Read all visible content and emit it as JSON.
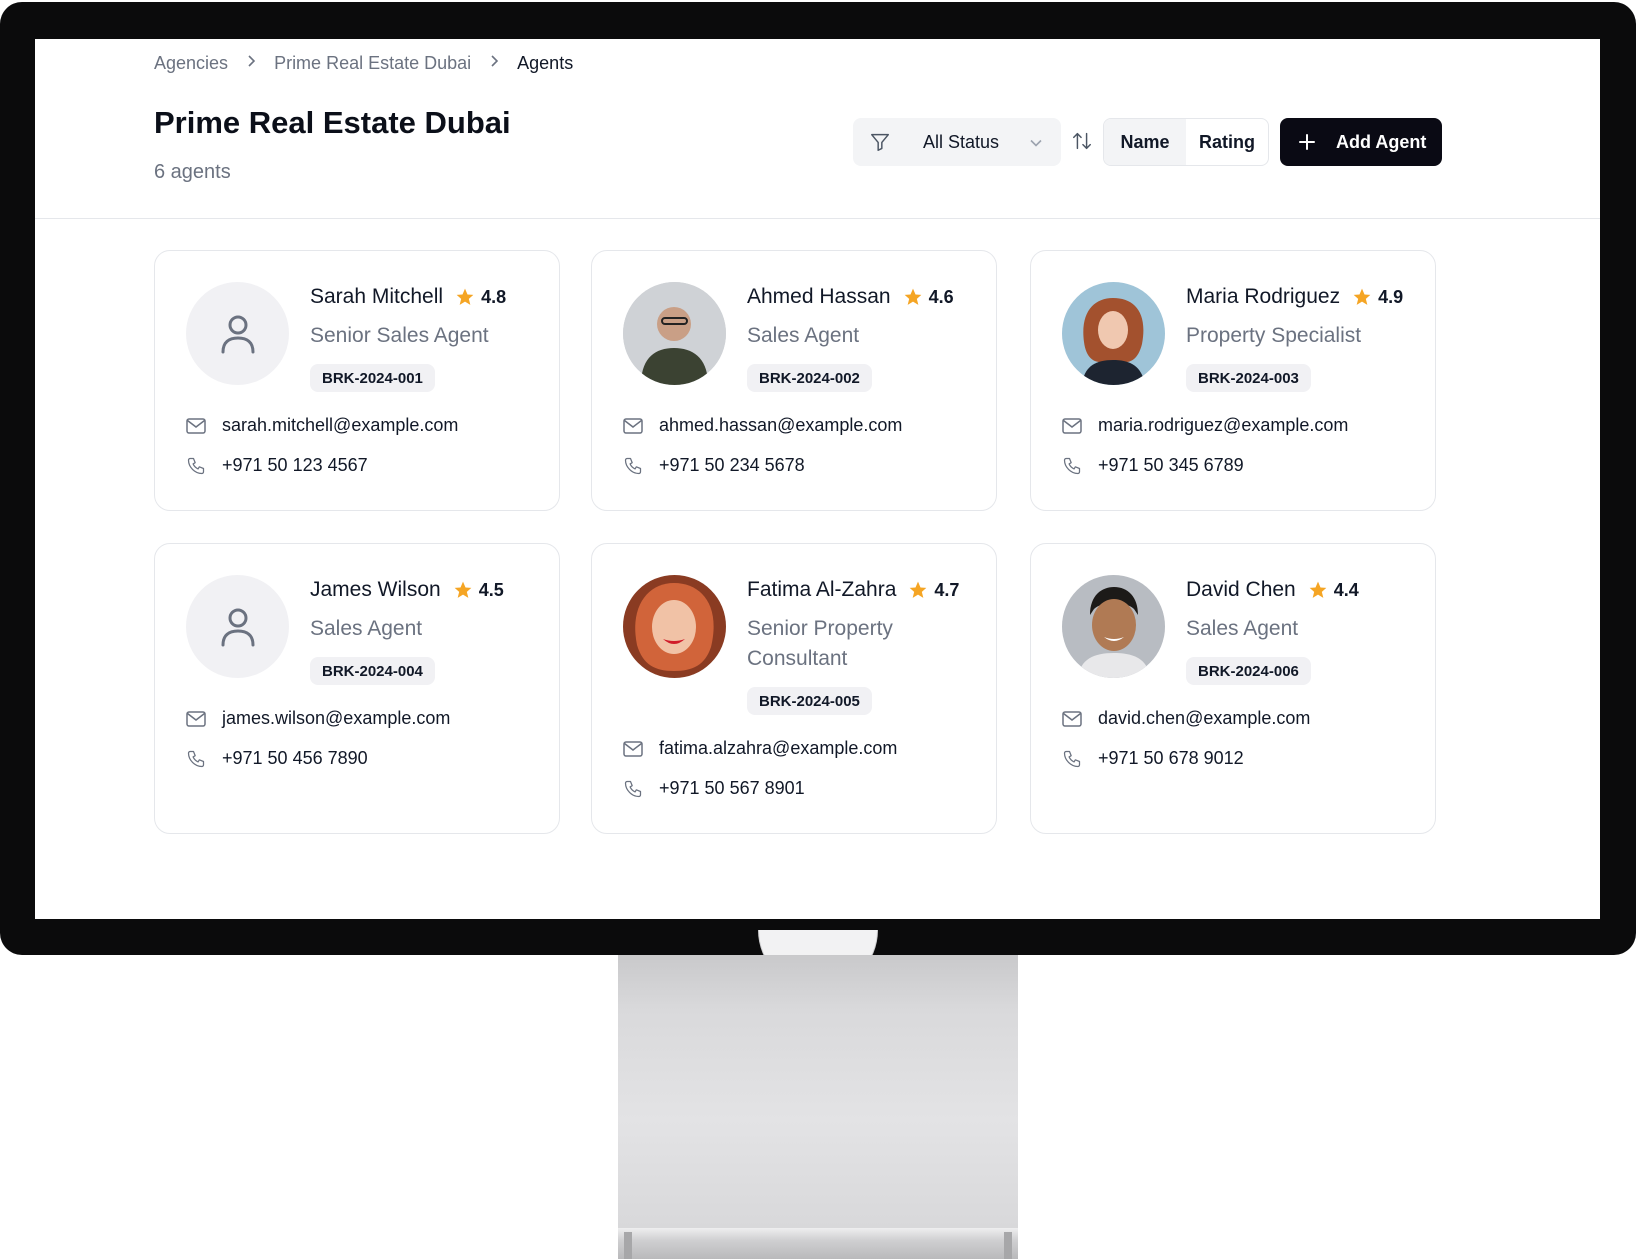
{
  "breadcrumb": [
    {
      "label": "Agencies"
    },
    {
      "label": "Prime Real Estate Dubai"
    },
    {
      "label": "Agents"
    }
  ],
  "page": {
    "title": "Prime Real Estate Dubai",
    "count_label": "6 agents"
  },
  "toolbar": {
    "status_filter": "All Status",
    "sort_options": [
      "Name",
      "Rating"
    ],
    "active_sort": "Name",
    "add_label": "Add Agent"
  },
  "colors": {
    "accent": "#0a0a14",
    "star": "#f5a524",
    "muted": "#6b7280"
  },
  "agents": [
    {
      "name": "Sarah Mitchell",
      "rating": "4.8",
      "role": "Senior Sales Agent",
      "id": "BRK-2024-001",
      "email": "sarah.mitchell@example.com",
      "phone": "+971 50 123 4567",
      "avatar": "placeholder-user-icon"
    },
    {
      "name": "Ahmed Hassan",
      "rating": "4.6",
      "role": "Sales Agent",
      "id": "BRK-2024-002",
      "email": "ahmed.hassan@example.com",
      "phone": "+971 50 234 5678",
      "avatar": "photo"
    },
    {
      "name": "Maria Rodriguez",
      "rating": "4.9",
      "role": "Property Specialist",
      "id": "BRK-2024-003",
      "email": "maria.rodriguez@example.com",
      "phone": "+971 50 345 6789",
      "avatar": "photo"
    },
    {
      "name": "James Wilson",
      "rating": "4.5",
      "role": "Sales Agent",
      "id": "BRK-2024-004",
      "email": "james.wilson@example.com",
      "phone": "+971 50 456 7890",
      "avatar": "placeholder-user-icon"
    },
    {
      "name": "Fatima Al-Zahra",
      "rating": "4.7",
      "role": "Senior Property Consultant",
      "id": "BRK-2024-005",
      "email": "fatima.alzahra@example.com",
      "phone": "+971 50 567 8901",
      "avatar": "photo"
    },
    {
      "name": "David Chen",
      "rating": "4.4",
      "role": "Sales Agent",
      "id": "BRK-2024-006",
      "email": "david.chen@example.com",
      "phone": "+971 50 678 9012",
      "avatar": "photo"
    }
  ]
}
